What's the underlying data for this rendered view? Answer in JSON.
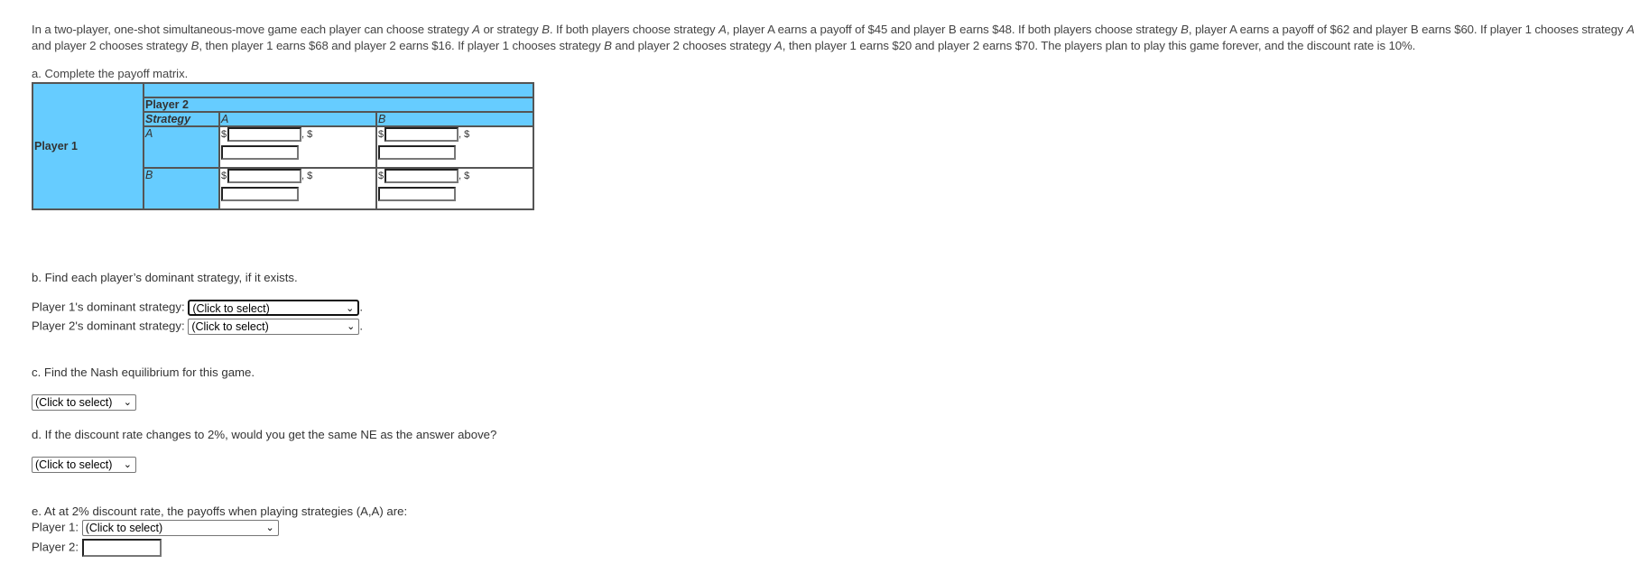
{
  "intro": {
    "segments": [
      "In a two-player, one-shot simultaneous-move game each player can choose strategy ",
      "A",
      " or strategy ",
      "B",
      ". If both players choose strategy ",
      "A",
      ", player A earns a payoff of $45 and player B earns $48. If both players choose strategy ",
      "B",
      ", player A earns a payoff of $62 and player B earns $60. If player 1 chooses strategy ",
      "A",
      " and player 2 chooses strategy ",
      "B",
      ", then player 1 earns $68 and player 2 earns $16. If player 1 chooses strategy ",
      "B",
      " and player 2 chooses strategy ",
      "A",
      ", then player 1 earns $20 and player 2 earns $70. The players plan to play this game forever, and the discount rate is 10%."
    ]
  },
  "part_a": {
    "label": "a. Complete the payoff matrix.",
    "player1": "Player 1",
    "player2": "Player 2",
    "strategy_header": "Strategy",
    "col_strategies": [
      "A",
      "B"
    ],
    "row_strategies": [
      "A",
      "B"
    ],
    "currency": "$",
    "separator": ", $",
    "cells": [
      [
        {
          "p1": "",
          "p2": ""
        },
        {
          "p1": "",
          "p2": ""
        }
      ],
      [
        {
          "p1": "",
          "p2": ""
        },
        {
          "p1": "",
          "p2": ""
        }
      ]
    ]
  },
  "part_b": {
    "label": "b. Find each player’s dominant strategy, if it exists.",
    "p1_label": "Player 1's dominant strategy:",
    "p2_label": "Player 2's dominant strategy:",
    "p1_value": "(Click to select)",
    "p2_value": "(Click to select)",
    "suffix": "."
  },
  "part_c": {
    "label": "c. Find the Nash equilibrium for this game.",
    "value": "(Click to select)"
  },
  "part_d": {
    "label": "d. If the discount rate changes to 2%, would you get the same NE as the answer above?",
    "value": "(Click to select)"
  },
  "part_e": {
    "label": "e. At at 2% discount rate, the payoffs when playing strategies (A,A) are:",
    "p1_label": "Player 1:",
    "p1_value": "(Click to select)",
    "p2_label": "Player 2:",
    "p2_value": ""
  },
  "icons": {
    "dropdown": "❯"
  },
  "colors": {
    "table_header": "#66CCFF"
  }
}
